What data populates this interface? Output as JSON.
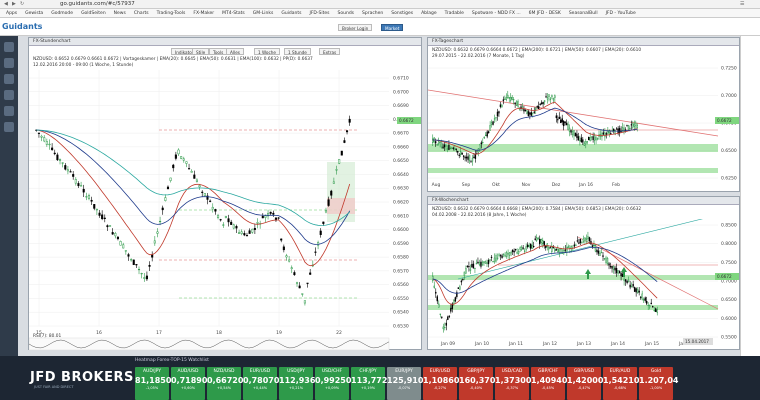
{
  "browser": {
    "url": "go.guidants.com/#c/57937"
  },
  "bookmarks": [
    "Apps",
    "Gewista",
    "Godmode",
    "GoldSeiten",
    "News",
    "Charts",
    "Trading-Tools",
    "FX-Maker",
    "MT4-Stats",
    "GM-Links",
    "Guidants",
    "JFD-Sites",
    "Sounds",
    "Sprachen",
    "Sonstiges",
    "Ablage",
    "Tradable",
    "Spotware - NDD FX ...",
    "6M JFD - DESK",
    "SeasonalBull",
    "JFD - YouTube"
  ],
  "app": {
    "logo": "Guidants",
    "broker_login": "Broker Login",
    "market_btn": "Market"
  },
  "left_panel": {
    "title": "FX-Stundenchart",
    "info_line1": "NZDUSD: 0.6652 0.6679 0.6661 0.6672 | Vortageskamer | EMA(20): 0.6645 | EMA(50): 0.6631 | EMA(100): 0.6632 | PP(D): 0.6637",
    "info_line2": "12.02.2016 20:00 - 09:00 (1 Woche, 1 Stunde)",
    "toolbar": [
      "Indikatoren",
      "Stile",
      "Tools",
      "Alles",
      "1 Woche",
      "1 Stunde",
      "Extras"
    ],
    "price_tag": "0.6672",
    "rsi_label": "RSI(7): 80.01",
    "x_labels": [
      "15",
      "16",
      "17",
      "18",
      "19",
      "22"
    ],
    "y_labels": [
      "0.6710",
      "0.6700",
      "0.6690",
      "0.6680",
      "0.6670",
      "0.6660",
      "0.6650",
      "0.6640",
      "0.6630",
      "0.6620",
      "0.6610",
      "0.6600",
      "0.6590",
      "0.6580",
      "0.6570",
      "0.6560",
      "0.6550",
      "0.6540",
      "0.6530"
    ]
  },
  "top_right_panel": {
    "title": "FX-Tageschart",
    "info_line1": "NZDUSD: 0.6632 0.6679 0.6664 0.6672 | EMA(200): 0.6721 | EMA(50): 0.6607 | EMA(20): 0.6610",
    "info_line2": "29.07.2015 - 22.02.2016 (7 Monate, 1 Tag)",
    "price_tag": "0.6672",
    "x_labels": [
      "Aug",
      "Sep",
      "Okt",
      "Nov",
      "Dez",
      "Jan 16",
      "Feb"
    ],
    "y_labels": [
      "0.7250",
      "0.7000",
      "0.6750",
      "0.6500",
      "0.6250"
    ]
  },
  "bottom_right_panel": {
    "title": "FX-Wochenchart",
    "info_line1": "NZDUSD: 0.6632 0.6679 0.6664 0.6668 | EMA(200): 0.7584 | EMA(50): 0.6853 | EMA(20): 0.6632",
    "info_line2": "04.02.2008 - 22.02.2016 (8 Jahre, 1 Woche)",
    "price_tag": "0.6672",
    "date_tag": "15.04.2017",
    "x_labels": [
      "Jan 09",
      "Jan 10",
      "Jan 11",
      "Jan 12",
      "Jan 13",
      "Jan 14",
      "Jan 15",
      "Jan 16"
    ],
    "y_labels": [
      "0.8500",
      "0.8000",
      "0.7500",
      "0.7000",
      "0.6500",
      "0.6000",
      "0.5500"
    ]
  },
  "watchlist": {
    "title": "Heatmap Forex-TOP-15 Watchlist",
    "brand": "JFD BROKERS",
    "brand_sub": "JUST FAIR AND DIRECT",
    "tiles": [
      {
        "sym": "AUD/JPY",
        "px": "81,18500",
        "chg": "-1,05%",
        "color": "green"
      },
      {
        "sym": "AUD/USD",
        "px": "0,71890",
        "chg": "+0,60%",
        "color": "green"
      },
      {
        "sym": "NZD/USD",
        "px": "0,66720",
        "chg": "+0,54%",
        "color": "green"
      },
      {
        "sym": "EUR/USD",
        "px": "0,78070",
        "chg": "+0,44%",
        "color": "green"
      },
      {
        "sym": "USD/JPY",
        "px": "112,93600",
        "chg": "+0,21%",
        "color": "green"
      },
      {
        "sym": "USD/CHF",
        "px": "0,99250",
        "chg": "+0,09%",
        "color": "green"
      },
      {
        "sym": "CHF/JPY",
        "px": "113,77200",
        "chg": "+0,19%",
        "color": "green"
      },
      {
        "sym": "EUR/JPY",
        "px": "125,91000",
        "chg": "-0,07%",
        "color": "grey"
      },
      {
        "sym": "EUR/USD",
        "px": "1,10860",
        "chg": "-0,27%",
        "color": "red"
      },
      {
        "sym": "GBP/JPY",
        "px": "160,37000",
        "chg": "-0,40%",
        "color": "red"
      },
      {
        "sym": "USD/CAD",
        "px": "1,37300",
        "chg": "-0,37%",
        "color": "red"
      },
      {
        "sym": "GBP/CHF",
        "px": "1,40940",
        "chg": "-0,45%",
        "color": "red"
      },
      {
        "sym": "GBP/USD",
        "px": "1,42000",
        "chg": "-0,47%",
        "color": "red"
      },
      {
        "sym": "EUR/AUD",
        "px": "1,54210",
        "chg": "-0,68%",
        "color": "red"
      },
      {
        "sym": "Gold",
        "px": "1.207,04",
        "chg": "-1,00%",
        "color": "red"
      }
    ]
  },
  "colors": {
    "candle_up": "#2e9a4a",
    "candle_down": "#000000",
    "ema_red": "#c0392b",
    "ema_blue": "#1f3b8c",
    "ema_teal": "#2aa8a0",
    "support_green": "#7fd67f",
    "resistance_red": "#e07070"
  }
}
